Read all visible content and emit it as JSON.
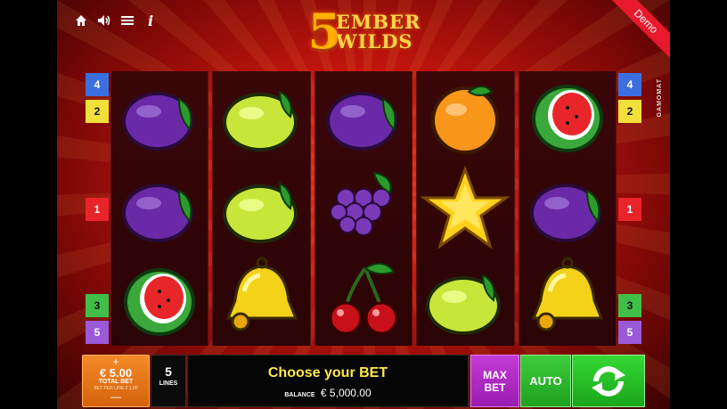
{
  "logo": {
    "number": "5",
    "word1": "EMBER",
    "word2": "WILDS"
  },
  "demo_label": "Demo",
  "provider": "GAMOMAT",
  "toolbar": [
    "home-icon",
    "sound-icon",
    "menu-icon",
    "info-icon"
  ],
  "reels": [
    [
      "plum",
      "plum",
      "watermelon"
    ],
    [
      "lemon",
      "lemon",
      "bell"
    ],
    [
      "plum",
      "grapes",
      "cherries"
    ],
    [
      "orange",
      "star",
      "lemon"
    ],
    [
      "watermelon",
      "plum",
      "bell"
    ]
  ],
  "line_markers": {
    "left": [
      {
        "n": "4",
        "color": "#3b6fe0",
        "row": "top-a"
      },
      {
        "n": "2",
        "color": "#f2e03a",
        "row": "top-b"
      },
      {
        "n": "1",
        "color": "#e8242a",
        "row": "mid"
      },
      {
        "n": "3",
        "color": "#3fbf48",
        "row": "bot-a"
      },
      {
        "n": "5",
        "color": "#9a5ad8",
        "row": "bot-b"
      }
    ],
    "right": [
      {
        "n": "4",
        "color": "#3b6fe0",
        "row": "top-a"
      },
      {
        "n": "2",
        "color": "#f2e03a",
        "row": "top-b"
      },
      {
        "n": "1",
        "color": "#e8242a",
        "row": "mid"
      },
      {
        "n": "3",
        "color": "#3fbf48",
        "row": "bot-a"
      },
      {
        "n": "5",
        "color": "#9a5ad8",
        "row": "bot-b"
      }
    ]
  },
  "controls": {
    "bet": {
      "plus": "+",
      "amount": "€ 5.00",
      "label": "TOTAL BET",
      "sub": "BET PER LINE € 1.00",
      "minus": "—"
    },
    "lines": {
      "value": "5",
      "label": "LINES"
    },
    "message": "Choose your BET",
    "balance_label": "BALANCE",
    "balance": "€ 5,000.00",
    "max_bet": [
      "MAX",
      "BET"
    ],
    "auto": "AUTO"
  }
}
